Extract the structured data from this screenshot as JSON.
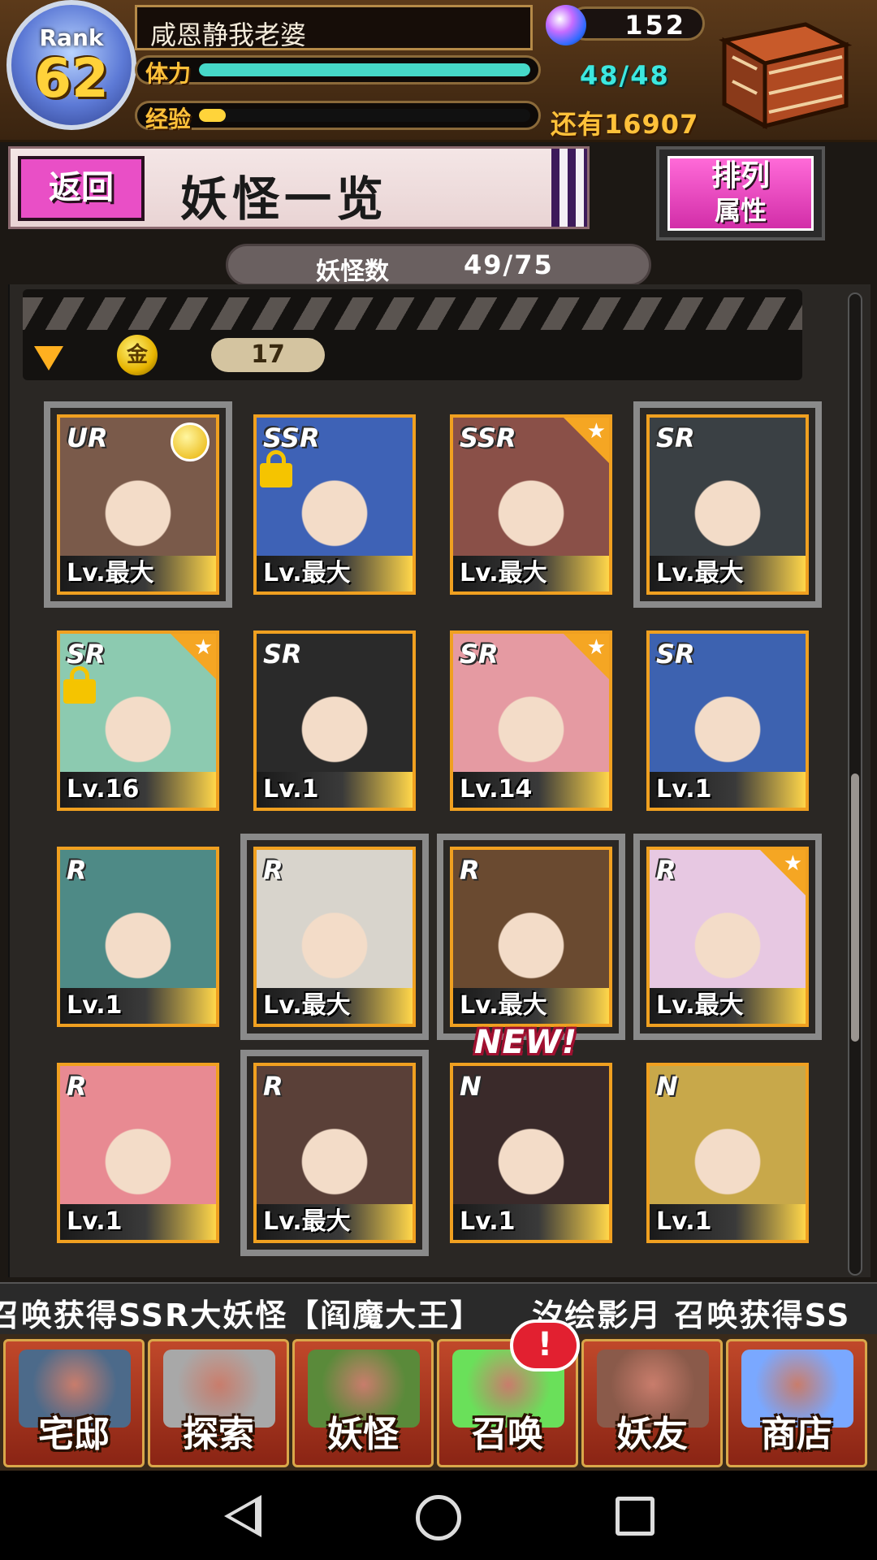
{
  "header": {
    "rank_label": "Rank",
    "rank_value": "62",
    "player_name": "咸恩静我老婆",
    "gem_count": "152",
    "stamina_label": "体力",
    "stamina_value": "48/48",
    "stamina_fraction": 1.0,
    "exp_label": "经验",
    "exp_remaining": "还有16907",
    "exp_fraction": 0.08,
    "colors": {
      "stamina_fill": "#46d8c8",
      "exp_fill": "#ffd43a"
    }
  },
  "titlebar": {
    "back_label": "返回",
    "title": "妖怪一览",
    "sort_line1": "排列",
    "sort_line2": "属性"
  },
  "count": {
    "label": "妖怪数",
    "value": "49/75"
  },
  "filter": {
    "coin_glyph": "金",
    "count": "17"
  },
  "cards": [
    {
      "rarity": "UR",
      "level": "Lv.最大",
      "selected": true,
      "star": false,
      "lock": false,
      "medal": true,
      "color": "#7a5a4a"
    },
    {
      "rarity": "SSR",
      "level": "Lv.最大",
      "selected": false,
      "star": false,
      "lock": true,
      "medal": false,
      "color": "#3e62b6"
    },
    {
      "rarity": "SSR",
      "level": "Lv.最大",
      "selected": false,
      "star": true,
      "lock": false,
      "medal": false,
      "color": "#8a5048"
    },
    {
      "rarity": "SR",
      "level": "Lv.最大",
      "selected": true,
      "star": false,
      "lock": false,
      "medal": false,
      "color": "#3a4044"
    },
    {
      "rarity": "SR",
      "level": "Lv.16",
      "selected": false,
      "star": true,
      "lock": true,
      "medal": false,
      "color": "#8ccab0"
    },
    {
      "rarity": "SR",
      "level": "Lv.1",
      "selected": false,
      "star": false,
      "lock": false,
      "medal": false,
      "color": "#2a2a2a"
    },
    {
      "rarity": "SR",
      "level": "Lv.14",
      "selected": false,
      "star": true,
      "lock": false,
      "medal": false,
      "color": "#e59aa2"
    },
    {
      "rarity": "SR",
      "level": "Lv.1",
      "selected": false,
      "star": false,
      "lock": false,
      "medal": false,
      "color": "#3d62b0"
    },
    {
      "rarity": "R",
      "level": "Lv.1",
      "selected": false,
      "star": false,
      "lock": false,
      "medal": false,
      "color": "#4e8a86"
    },
    {
      "rarity": "R",
      "level": "Lv.最大",
      "selected": true,
      "star": false,
      "lock": false,
      "medal": false,
      "color": "#d8d4cc"
    },
    {
      "rarity": "R",
      "level": "Lv.最大",
      "selected": true,
      "star": false,
      "lock": false,
      "medal": false,
      "color": "#6a4a30"
    },
    {
      "rarity": "R",
      "level": "Lv.最大",
      "selected": true,
      "star": true,
      "lock": false,
      "medal": false,
      "color": "#e7c8e2"
    },
    {
      "rarity": "R",
      "level": "Lv.1",
      "selected": false,
      "star": false,
      "lock": false,
      "medal": false,
      "color": "#e88a92"
    },
    {
      "rarity": "R",
      "level": "Lv.最大",
      "selected": true,
      "star": false,
      "lock": false,
      "medal": false,
      "color": "#5a4038"
    },
    {
      "rarity": "N",
      "level": "Lv.1",
      "selected": false,
      "star": false,
      "lock": false,
      "medal": false,
      "color": "#3a2a2a",
      "new_badge": "NEW!"
    },
    {
      "rarity": "N",
      "level": "Lv.1",
      "selected": false,
      "star": false,
      "lock": false,
      "medal": false,
      "color": "#c8a84a"
    }
  ],
  "ticker": {
    "text": "召唤获得SSR大妖怪【阎魔大王】　　汐绘影月 召唤获得SS"
  },
  "nav": {
    "items": [
      {
        "label": "宅邸",
        "icon": "mansion-icon",
        "color": "#4c6a8a"
      },
      {
        "label": "探索",
        "icon": "magnifier-icon",
        "color": "#a8a8a8"
      },
      {
        "label": "妖怪",
        "icon": "scroll-icon",
        "color": "#5a8a3a"
      },
      {
        "label": "召唤",
        "icon": "pentagram-icon",
        "color": "#6ae05a"
      },
      {
        "label": "妖友",
        "icon": "catgirl-friend-icon",
        "color": "#8a5a4a"
      },
      {
        "label": "商店",
        "icon": "crystal-orb-icon",
        "color": "#7aa8ff"
      }
    ],
    "alert": "!"
  }
}
